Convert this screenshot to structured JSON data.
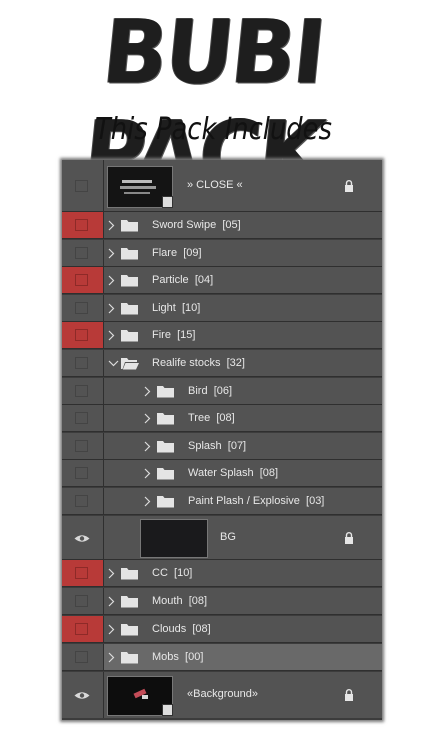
{
  "header": {
    "brand_title": "BUBI PACK",
    "subtitle": "This Pack Includes"
  },
  "layers_panel": {
    "top_layer": {
      "label": "» CLOSE «",
      "visible": false,
      "locked": true
    },
    "groups": [
      {
        "label": "Sword Swipe",
        "count": "[05]",
        "marked": true
      },
      {
        "label": "Flare",
        "count": "[09]",
        "marked": false
      },
      {
        "label": "Particle",
        "count": "[04]",
        "marked": true
      },
      {
        "label": "Light",
        "count": "[10]",
        "marked": false
      },
      {
        "label": "Fire",
        "count": "[15]",
        "marked": true
      },
      {
        "label": "Realife stocks",
        "count": "[32]",
        "marked": false,
        "expanded": true
      },
      {
        "label": "Bird",
        "count": "[06]",
        "marked": false,
        "nested": true
      },
      {
        "label": "Tree",
        "count": "[08]",
        "marked": false,
        "nested": true
      },
      {
        "label": "Splash",
        "count": "[07]",
        "marked": false,
        "nested": true
      },
      {
        "label": "Water Splash",
        "count": "[08]",
        "marked": false,
        "nested": true
      },
      {
        "label": "Paint Plash / Explosive",
        "count": "[03]",
        "marked": false,
        "nested": true
      }
    ],
    "bg_layer": {
      "label": "BG",
      "visible": true,
      "locked": true
    },
    "groups_bottom": [
      {
        "label": "CC",
        "count": "[10]",
        "marked": true
      },
      {
        "label": "Mouth",
        "count": "[08]",
        "marked": false
      },
      {
        "label": "Clouds",
        "count": "[08]",
        "marked": true
      },
      {
        "label": "Mobs",
        "count": "[00]",
        "marked": false,
        "selected": true
      }
    ],
    "background_layer": {
      "label": "«Background»",
      "visible": true,
      "locked": true
    },
    "colors": {
      "panel_bg": "#535353",
      "marked_red": "#b83a38",
      "selected_row": "#696969"
    }
  }
}
